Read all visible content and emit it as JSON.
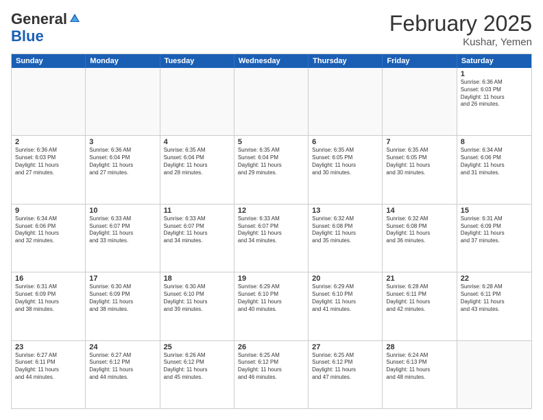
{
  "logo": {
    "general": "General",
    "blue": "Blue"
  },
  "header": {
    "month": "February 2025",
    "location": "Kushar, Yemen"
  },
  "weekdays": [
    "Sunday",
    "Monday",
    "Tuesday",
    "Wednesday",
    "Thursday",
    "Friday",
    "Saturday"
  ],
  "weeks": [
    [
      {
        "day": "",
        "info": ""
      },
      {
        "day": "",
        "info": ""
      },
      {
        "day": "",
        "info": ""
      },
      {
        "day": "",
        "info": ""
      },
      {
        "day": "",
        "info": ""
      },
      {
        "day": "",
        "info": ""
      },
      {
        "day": "1",
        "info": "Sunrise: 6:36 AM\nSunset: 6:03 PM\nDaylight: 11 hours\nand 26 minutes."
      }
    ],
    [
      {
        "day": "2",
        "info": "Sunrise: 6:36 AM\nSunset: 6:03 PM\nDaylight: 11 hours\nand 27 minutes."
      },
      {
        "day": "3",
        "info": "Sunrise: 6:36 AM\nSunset: 6:04 PM\nDaylight: 11 hours\nand 27 minutes."
      },
      {
        "day": "4",
        "info": "Sunrise: 6:35 AM\nSunset: 6:04 PM\nDaylight: 11 hours\nand 28 minutes."
      },
      {
        "day": "5",
        "info": "Sunrise: 6:35 AM\nSunset: 6:04 PM\nDaylight: 11 hours\nand 29 minutes."
      },
      {
        "day": "6",
        "info": "Sunrise: 6:35 AM\nSunset: 6:05 PM\nDaylight: 11 hours\nand 30 minutes."
      },
      {
        "day": "7",
        "info": "Sunrise: 6:35 AM\nSunset: 6:05 PM\nDaylight: 11 hours\nand 30 minutes."
      },
      {
        "day": "8",
        "info": "Sunrise: 6:34 AM\nSunset: 6:06 PM\nDaylight: 11 hours\nand 31 minutes."
      }
    ],
    [
      {
        "day": "9",
        "info": "Sunrise: 6:34 AM\nSunset: 6:06 PM\nDaylight: 11 hours\nand 32 minutes."
      },
      {
        "day": "10",
        "info": "Sunrise: 6:33 AM\nSunset: 6:07 PM\nDaylight: 11 hours\nand 33 minutes."
      },
      {
        "day": "11",
        "info": "Sunrise: 6:33 AM\nSunset: 6:07 PM\nDaylight: 11 hours\nand 34 minutes."
      },
      {
        "day": "12",
        "info": "Sunrise: 6:33 AM\nSunset: 6:07 PM\nDaylight: 11 hours\nand 34 minutes."
      },
      {
        "day": "13",
        "info": "Sunrise: 6:32 AM\nSunset: 6:08 PM\nDaylight: 11 hours\nand 35 minutes."
      },
      {
        "day": "14",
        "info": "Sunrise: 6:32 AM\nSunset: 6:08 PM\nDaylight: 11 hours\nand 36 minutes."
      },
      {
        "day": "15",
        "info": "Sunrise: 6:31 AM\nSunset: 6:09 PM\nDaylight: 11 hours\nand 37 minutes."
      }
    ],
    [
      {
        "day": "16",
        "info": "Sunrise: 6:31 AM\nSunset: 6:09 PM\nDaylight: 11 hours\nand 38 minutes."
      },
      {
        "day": "17",
        "info": "Sunrise: 6:30 AM\nSunset: 6:09 PM\nDaylight: 11 hours\nand 38 minutes."
      },
      {
        "day": "18",
        "info": "Sunrise: 6:30 AM\nSunset: 6:10 PM\nDaylight: 11 hours\nand 39 minutes."
      },
      {
        "day": "19",
        "info": "Sunrise: 6:29 AM\nSunset: 6:10 PM\nDaylight: 11 hours\nand 40 minutes."
      },
      {
        "day": "20",
        "info": "Sunrise: 6:29 AM\nSunset: 6:10 PM\nDaylight: 11 hours\nand 41 minutes."
      },
      {
        "day": "21",
        "info": "Sunrise: 6:28 AM\nSunset: 6:11 PM\nDaylight: 11 hours\nand 42 minutes."
      },
      {
        "day": "22",
        "info": "Sunrise: 6:28 AM\nSunset: 6:11 PM\nDaylight: 11 hours\nand 43 minutes."
      }
    ],
    [
      {
        "day": "23",
        "info": "Sunrise: 6:27 AM\nSunset: 6:11 PM\nDaylight: 11 hours\nand 44 minutes."
      },
      {
        "day": "24",
        "info": "Sunrise: 6:27 AM\nSunset: 6:12 PM\nDaylight: 11 hours\nand 44 minutes."
      },
      {
        "day": "25",
        "info": "Sunrise: 6:26 AM\nSunset: 6:12 PM\nDaylight: 11 hours\nand 45 minutes."
      },
      {
        "day": "26",
        "info": "Sunrise: 6:25 AM\nSunset: 6:12 PM\nDaylight: 11 hours\nand 46 minutes."
      },
      {
        "day": "27",
        "info": "Sunrise: 6:25 AM\nSunset: 6:12 PM\nDaylight: 11 hours\nand 47 minutes."
      },
      {
        "day": "28",
        "info": "Sunrise: 6:24 AM\nSunset: 6:13 PM\nDaylight: 11 hours\nand 48 minutes."
      },
      {
        "day": "",
        "info": ""
      }
    ]
  ]
}
